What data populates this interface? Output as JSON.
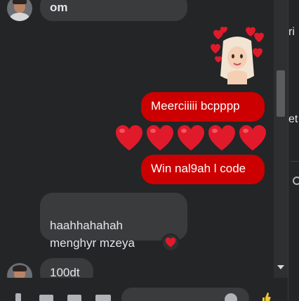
{
  "messages": {
    "top_incoming": "om",
    "outgoing_1": "Meerciiiii bcpppp",
    "outgoing_2": "Win nal9ah l code",
    "incoming_multi": "haahhahahah\nmenghyr mzeya",
    "bottom_incoming": "100dt"
  },
  "emoji_row": {
    "hearts": [
      "heart",
      "heart",
      "heart",
      "heart",
      "heart"
    ]
  },
  "reaction": {
    "emoji": "heart-reaction-icon"
  },
  "side_panel": {
    "text_top": "ri",
    "text_mid": "et"
  },
  "composer": {
    "placeholder": ""
  },
  "colors": {
    "outgoing_bubble": "#cc0000",
    "incoming_bubble": "#3a3b3c",
    "heart": "#e01a2b"
  }
}
